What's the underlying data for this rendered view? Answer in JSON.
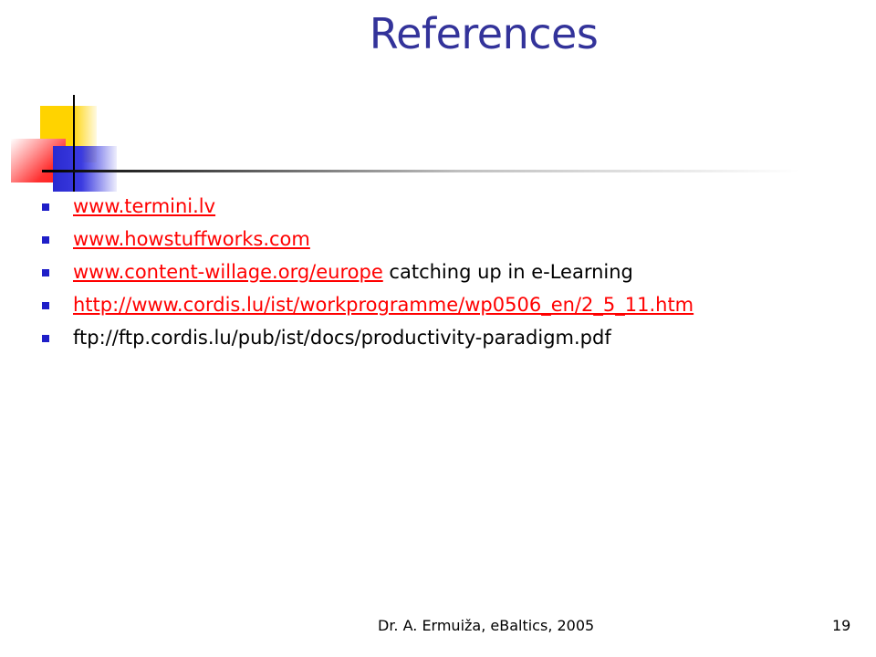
{
  "slide": {
    "title": "References",
    "items": [
      {
        "link": "www.termini.lv",
        "text": ""
      },
      {
        "link": "www.howstuffworks.com",
        "text": ""
      },
      {
        "link": "www.content-willage.org/europe",
        "text": " catching up in e-Learning"
      },
      {
        "link": "http://www.cordis.lu/ist/workprogramme/wp0506_en/2_5_11.htm",
        "text": ""
      },
      {
        "link": "",
        "text": "ftp://ftp.cordis.lu/pub/ist/docs/productivity-paradigm.pdf"
      }
    ],
    "footer": "Dr. A. Ermuiža, eBaltics, 2005",
    "page_number": "19"
  },
  "colors": {
    "title": "#33339a",
    "link": "#ff0000",
    "bullet": "#1f1fc8"
  }
}
